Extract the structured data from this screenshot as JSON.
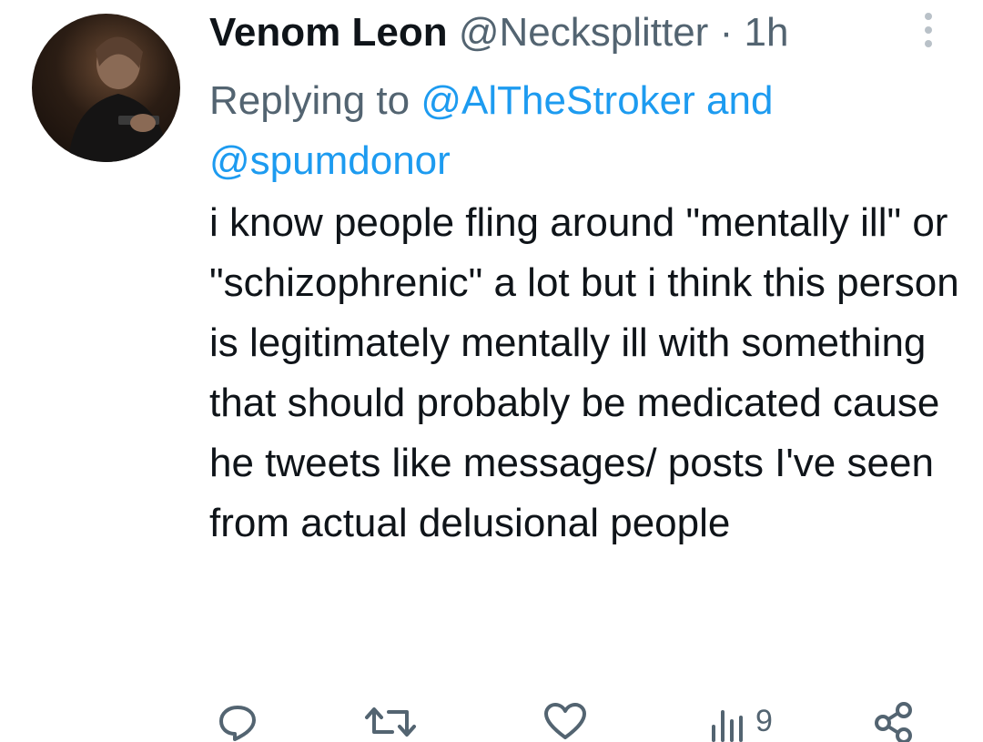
{
  "tweet": {
    "author_name": "Venom Leon",
    "author_handle": "@Necksplitter",
    "separator": "·",
    "time": "1h",
    "replying_prefix": "Replying to",
    "replying_to_1": "@AlTheStroker",
    "replying_and": "and",
    "replying_to_2": "@spumdonor",
    "text": "i know people fling around \"mentally ill\" or \"schizophrenic\" a lot but i think this person is legitimately mentally ill with something that should probably be medicated cause he tweets like messages/ posts I've seen from actual delusional people"
  },
  "actions": {
    "views_count": "9"
  },
  "icons": {
    "reply": "reply-icon",
    "retweet": "retweet-icon",
    "like": "heart-icon",
    "views": "views-chart-icon",
    "share": "share-icon",
    "more": "more-vertical-icon"
  }
}
